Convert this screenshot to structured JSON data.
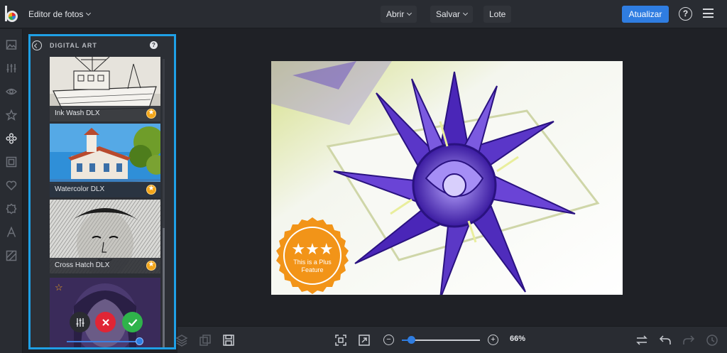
{
  "header": {
    "app_menu_label": "Editor de fotos",
    "open_label": "Abrir",
    "save_label": "Salvar",
    "batch_label": "Lote",
    "upgrade_label": "Atualizar",
    "help_label": "?"
  },
  "panel": {
    "title": "DIGITAL ART",
    "help_label": "?",
    "effects": [
      {
        "label": "Ink Wash DLX",
        "plus": true
      },
      {
        "label": "Watercolor DLX",
        "plus": true
      },
      {
        "label": "Cross Hatch DLX",
        "plus": true
      }
    ],
    "active_effect": {
      "favorite": false,
      "intensity": 0.96
    }
  },
  "canvas": {
    "plus_badge_text": "This is a Plus Feature"
  },
  "footer": {
    "zoom_level": "66%",
    "zoom_fraction": 0.12
  },
  "colors": {
    "accent": "#2f7de1",
    "selection_border": "#1fa0e6",
    "plus_orange": "#f2a51a",
    "cancel_red": "#e02535",
    "apply_green": "#2fb34b"
  }
}
